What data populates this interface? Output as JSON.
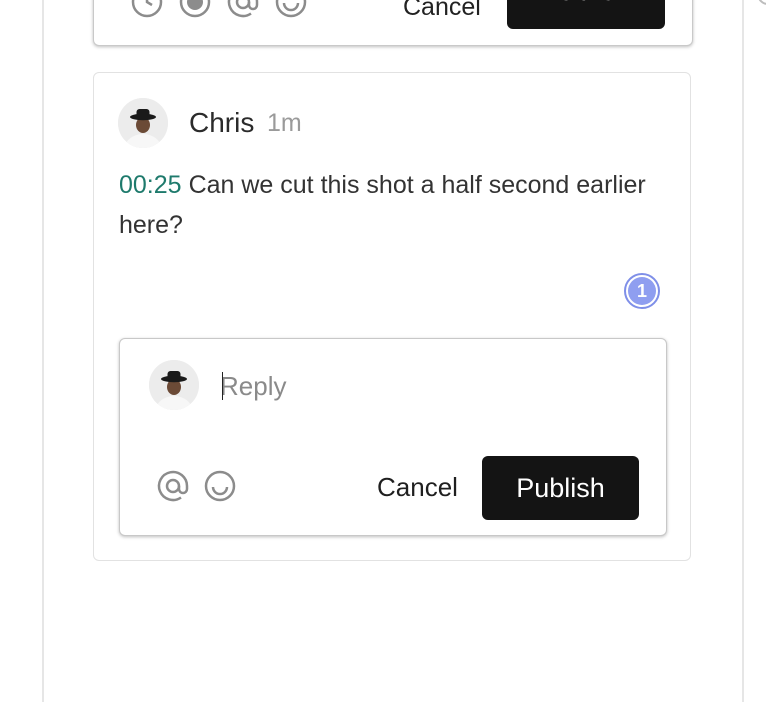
{
  "previous_composer": {
    "cancel_label": "Cancel",
    "publish_label": "Publish",
    "icons": [
      "clock-icon",
      "record-icon",
      "at-icon",
      "emoji-icon"
    ]
  },
  "comment": {
    "author": "Chris",
    "time": "1m",
    "timestamp": "00:25",
    "text": "Can we cut this shot a half second earlier here?",
    "reply_count": "1"
  },
  "reply_composer": {
    "placeholder": "Reply",
    "cancel_label": "Cancel",
    "publish_label": "Publish",
    "icons": [
      "at-icon",
      "emoji-icon"
    ]
  },
  "colors": {
    "timestamp": "#1e7a6c",
    "badge": "#8f9ef0",
    "button": "#141414"
  }
}
